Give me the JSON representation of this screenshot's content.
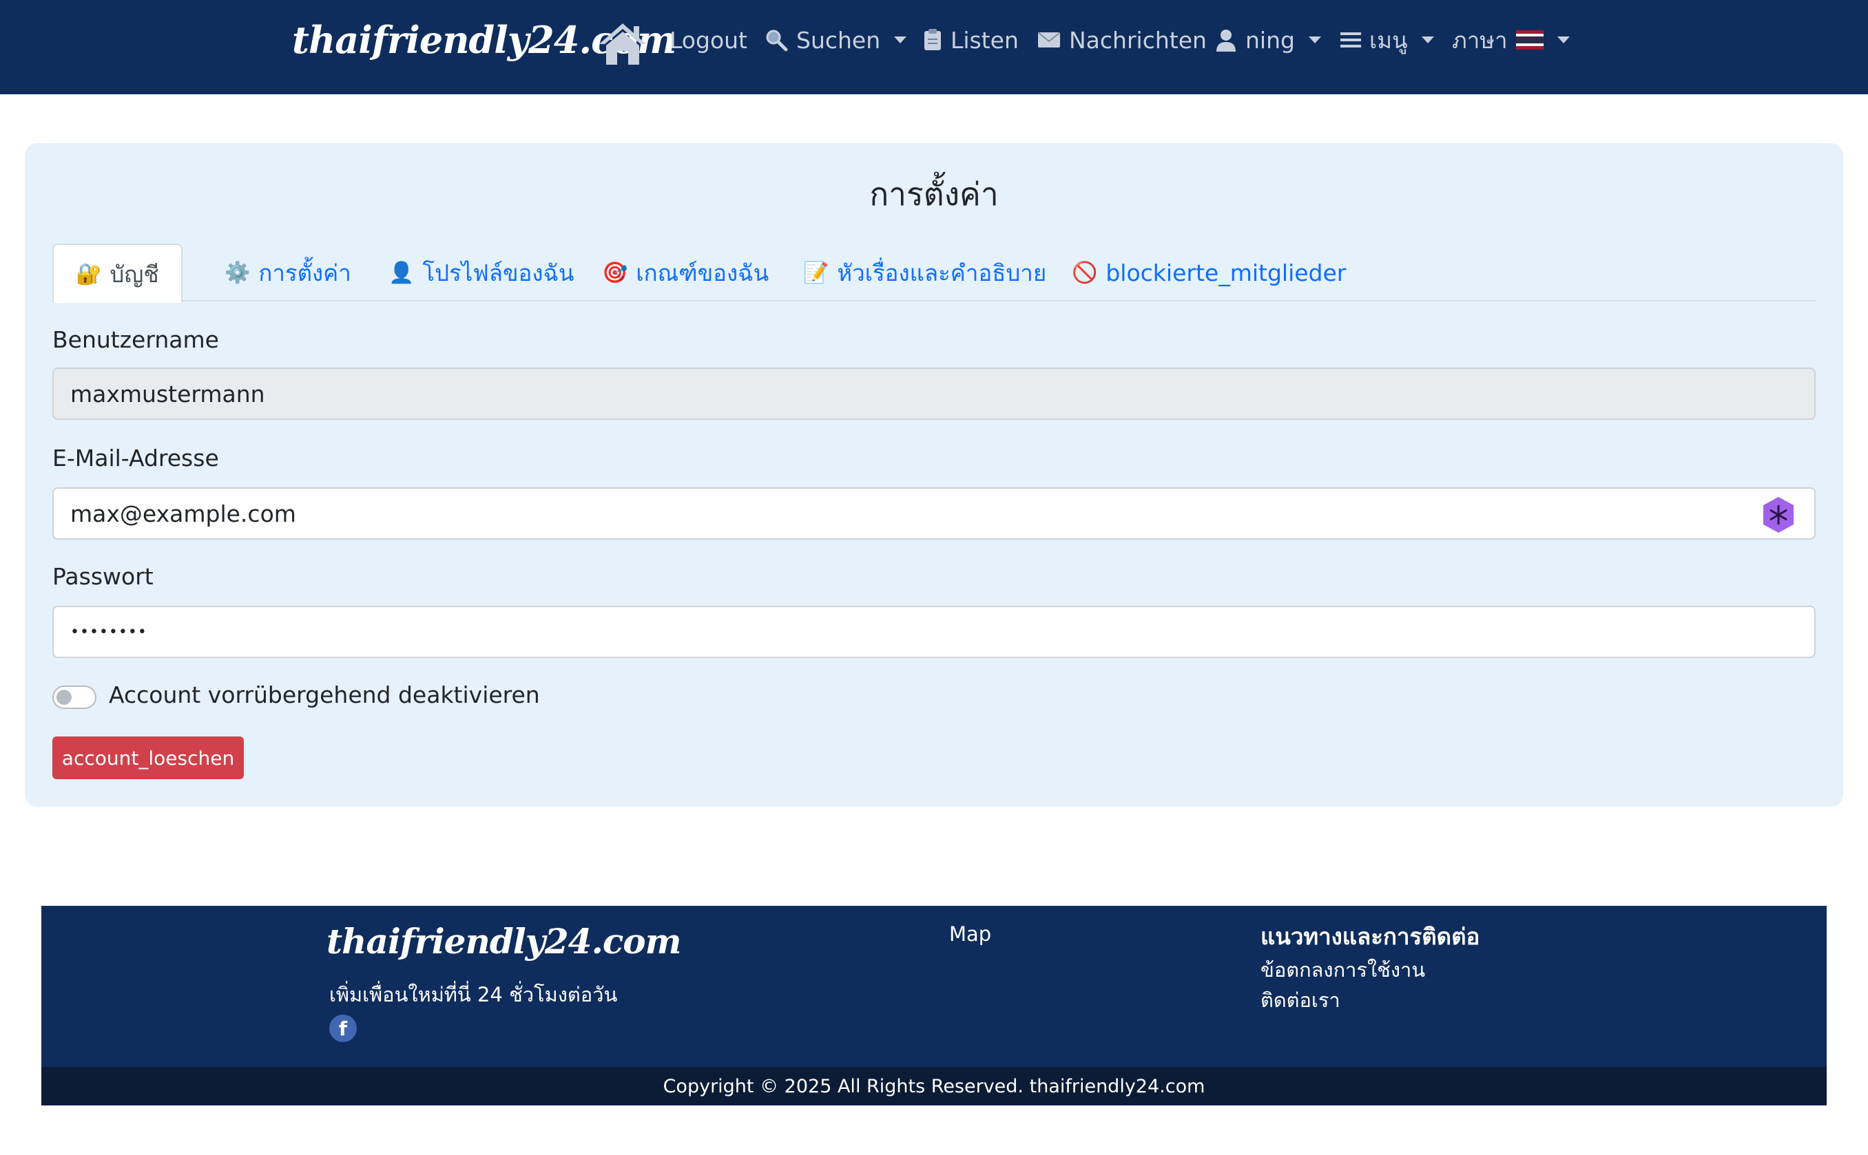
{
  "navbar": {
    "brand": "thaifriendly24.com",
    "logout": "Logout",
    "search": "Suchen",
    "lists": "Listen",
    "messages": "Nachrichten",
    "user": "ning",
    "menu": "เมนู",
    "language": "ภาษา",
    "icons": {
      "home": "home-icon",
      "search": "magnifier-icon",
      "lists": "clipboard-icon",
      "messages": "envelope-icon",
      "user": "user-icon",
      "menu": "hamburger-icon",
      "flag": "thai-flag-icon"
    }
  },
  "settings": {
    "title": "การตั้งค่า",
    "tabs": [
      {
        "label": "บัญชี",
        "icon": "lock-key-icon",
        "active": true
      },
      {
        "label": "การตั้งค่า",
        "icon": "gear-icon",
        "active": false
      },
      {
        "label": "โปรไฟล์ของฉัน",
        "icon": "user-icon",
        "active": false
      },
      {
        "label": "เกณฑ์ของฉัน",
        "icon": "target-icon",
        "active": false
      },
      {
        "label": "หัวเรื่องและคำอธิบาย",
        "icon": "memo-icon",
        "active": false
      },
      {
        "label": "blockierte_mitglieder",
        "icon": "prohibited-icon",
        "active": false
      }
    ],
    "username_label": "Benutzername",
    "username_value": "maxmustermann",
    "email_label": "E-Mail-Adresse",
    "email_value": "max@example.com",
    "password_label": "Passwort",
    "password_value": "••••••••",
    "deactivate_label": "Account vorrübergehend deaktivieren",
    "deactivate_on": false,
    "delete_button": "account_loeschen"
  },
  "footer": {
    "brand": "thaifriendly24.com",
    "tagline": "เพิ่มเพื่อนใหม่ที่นี่ 24 ชั่วโมงต่อวัน",
    "facebook": "f",
    "map": "Map",
    "guide_heading": "แนวทางและการติดต่อ",
    "terms": "ข้อตกลงการใช้งาน",
    "contact": "ติดต่อเรา",
    "copyright": "Copyright © 2025 All Rights Reserved. thaifriendly24.com"
  },
  "colors": {
    "navbar": "#0f2d5c",
    "card": "#e5f1fb",
    "link": "#0d6efd",
    "danger": "#d1404b"
  }
}
